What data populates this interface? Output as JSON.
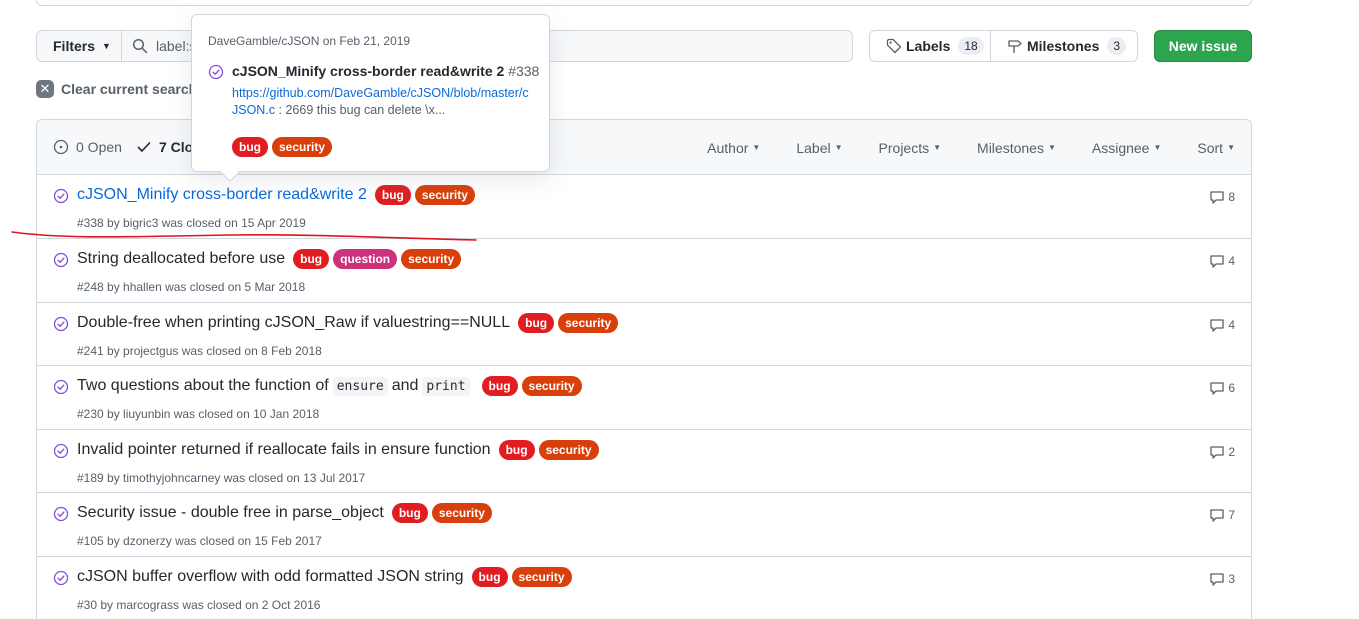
{
  "colors": {
    "bug": "#e11d21",
    "question": "#cc317c",
    "security": "#d93f0b",
    "closed_icon": "#8250df",
    "link": "#0969da",
    "new_issue": "#2da44e"
  },
  "toolbar": {
    "filters_label": "Filters",
    "search_value": "label:s",
    "labels_label": "Labels",
    "labels_count": "18",
    "milestones_label": "Milestones",
    "milestones_count": "3",
    "new_issue_label": "New issue",
    "clear_search_label": "Clear current search"
  },
  "header": {
    "open_label": "0 Open",
    "closed_label": "7 Closed",
    "filters": [
      "Author",
      "Label",
      "Projects",
      "Milestones",
      "Assignee",
      "Sort"
    ]
  },
  "popover": {
    "repo_date": "DaveGamble/cJSON on Feb 21, 2019",
    "title": "cJSON_Minify cross-border read&write 2",
    "number": "#338",
    "url": "https://github.com/DaveGamble/cJSON/blob/master/cJSON.c",
    "body_rest": " : 2669 this bug can delete \\x...",
    "labels": [
      "bug",
      "security"
    ]
  },
  "issues": [
    {
      "title": "cJSON_Minify cross-border read&write 2",
      "meta": "#338 by bigric3 was closed on 15 Apr 2019",
      "labels": [
        "bug",
        "security"
      ],
      "comments": "8"
    },
    {
      "title": "String deallocated before use",
      "meta": "#248 by hhallen was closed on 5 Mar 2018",
      "labels": [
        "bug",
        "question",
        "security"
      ],
      "comments": "4"
    },
    {
      "title": "Double-free when printing cJSON_Raw if valuestring==NULL",
      "meta": "#241 by projectgus was closed on 8 Feb 2018",
      "labels": [
        "bug",
        "security"
      ],
      "comments": "4"
    },
    {
      "title_parts": [
        "Two questions about the function of",
        "ensure",
        "and",
        "print"
      ],
      "meta": "#230 by liuyunbin was closed on 10 Jan 2018",
      "labels": [
        "bug",
        "security"
      ],
      "comments": "6"
    },
    {
      "title": "Invalid pointer returned if reallocate fails in ensure function",
      "meta": "#189 by timothyjohncarney was closed on 13 Jul 2017",
      "labels": [
        "bug",
        "security"
      ],
      "comments": "2"
    },
    {
      "title": "Security issue - double free in parse_object",
      "meta": "#105 by dzonerzy was closed on 15 Feb 2017",
      "labels": [
        "bug",
        "security"
      ],
      "comments": "7"
    },
    {
      "title": "cJSON buffer overflow with odd formatted JSON string",
      "meta": "#30 by marcograss was closed on 2 Oct 2016",
      "labels": [
        "bug",
        "security"
      ],
      "comments": "3"
    }
  ]
}
